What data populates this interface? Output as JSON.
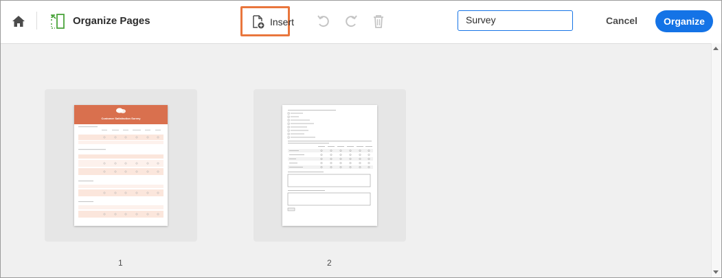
{
  "toolbar": {
    "title": "Organize Pages",
    "insert_label": "Insert",
    "search_value": "Survey",
    "cancel_label": "Cancel",
    "organize_label": "Organize"
  },
  "pages": [
    {
      "number": "1",
      "title": "Customer Satisfaction Survey"
    },
    {
      "number": "2"
    }
  ],
  "colors": {
    "accent": "#1473e6",
    "highlight": "#e9763c",
    "survey_header": "#d9704e"
  }
}
